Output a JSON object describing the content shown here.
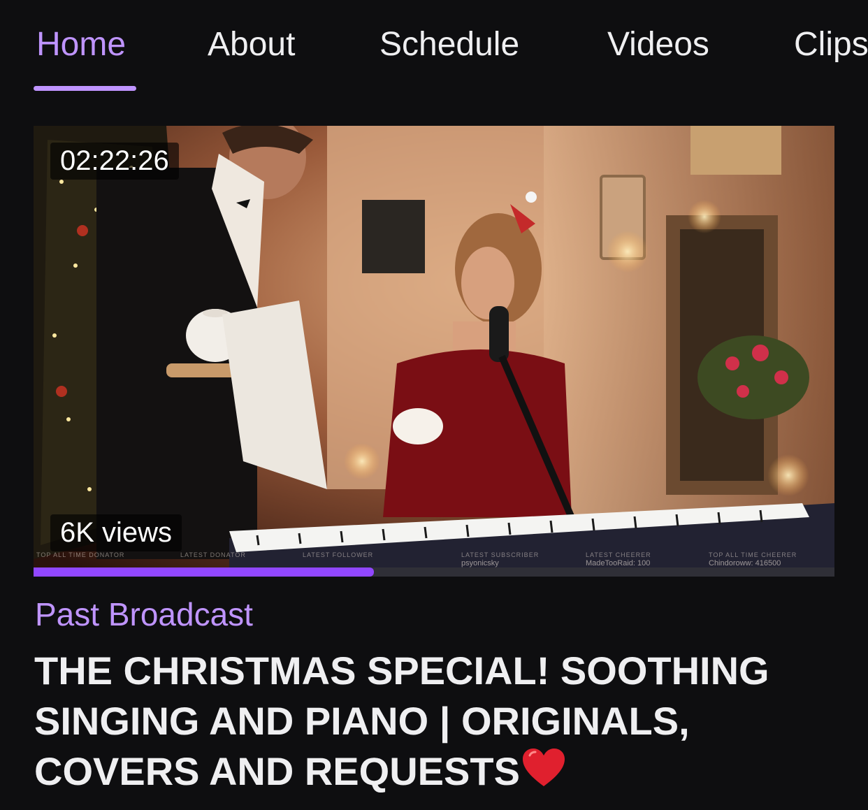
{
  "nav": {
    "tabs": [
      {
        "label": "Home",
        "active": true
      },
      {
        "label": "About",
        "active": false
      },
      {
        "label": "Schedule",
        "active": false
      },
      {
        "label": "Videos",
        "active": false
      },
      {
        "label": "Clips",
        "active": false
      }
    ],
    "accent_color": "#bf94ff"
  },
  "video": {
    "duration": "02:22:26",
    "views": "6K views",
    "watched_fraction": 0.425,
    "progress_color": "#9147ff",
    "stream_overlay": [
      {
        "heading": "TOP ALL TIME DONATOR",
        "value": ""
      },
      {
        "heading": "LATEST DONATOR",
        "value": ""
      },
      {
        "heading": "LATEST FOLLOWER",
        "value": ""
      },
      {
        "heading": "LATEST SUBSCRIBER",
        "value": "psyonicsky"
      },
      {
        "heading": "LATEST CHEERER",
        "value": "MadeTooRaid: 100"
      },
      {
        "heading": "TOP ALL TIME CHEERER",
        "value": "Chindoroww: 416500"
      }
    ]
  },
  "category": "Past Broadcast",
  "title": "THE CHRISTMAS SPECIAL! SOOTHING SINGING AND PIANO | ORIGINALS, COVERS AND REQUESTS",
  "title_emoji": "heart-icon"
}
